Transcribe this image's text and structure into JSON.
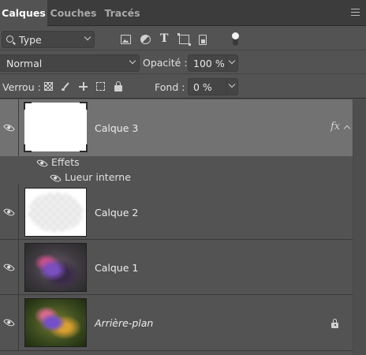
{
  "tabs": [
    {
      "label": "Calques",
      "active": true
    },
    {
      "label": "Couches",
      "active": false
    },
    {
      "label": "Tracés",
      "active": false
    }
  ],
  "filter": {
    "value": "Type",
    "icons": [
      "pixel-filter-icon",
      "adjustment-filter-icon",
      "type-filter-icon",
      "shape-filter-icon",
      "smart-object-filter-icon"
    ]
  },
  "blend": {
    "mode": "Normal",
    "opacity_label": "Opacité :",
    "opacity_value": "100 %"
  },
  "lock": {
    "label": "Verrou :",
    "fill_label": "Fond :",
    "fill_value": "0 %"
  },
  "layers": [
    {
      "name": "Calque 3",
      "selected": true,
      "thumbnail": "white",
      "has_fx": true,
      "fx_label": "fx",
      "effects_label": "Effets",
      "effect_items": [
        "Lueur interne"
      ]
    },
    {
      "name": "Calque 2",
      "selected": false,
      "thumbnail": "transparent"
    },
    {
      "name": "Calque 1",
      "selected": false,
      "thumbnail": "photo-flowers-grey"
    },
    {
      "name": "Arrière-plan",
      "selected": false,
      "thumbnail": "photo-flowers-green",
      "locked": true,
      "italic": true
    }
  ],
  "colors": {
    "panel": "#535353",
    "selected_row": "#727272",
    "tabbar": "#3c3c3c"
  }
}
